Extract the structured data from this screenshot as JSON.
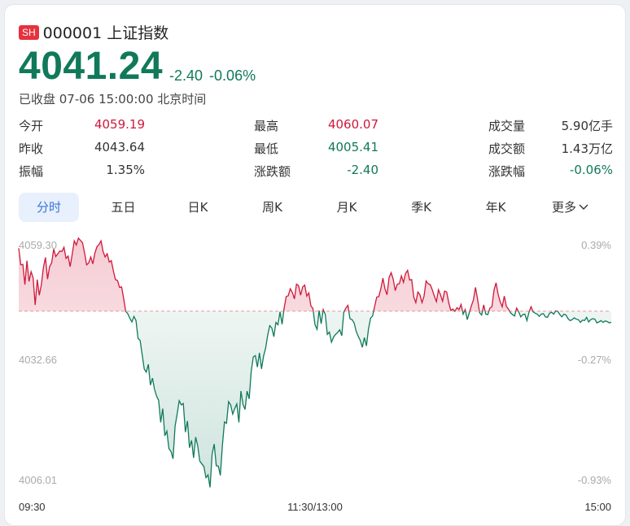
{
  "header": {
    "badge": "SH",
    "title": "000001 上证指数"
  },
  "quote": {
    "price": "4041.24",
    "change": "-2.40",
    "change_pct": "-0.06%",
    "status": "已收盘 07-06 15:00:00 北京时间"
  },
  "stats": [
    {
      "label": "今开",
      "value": "4059.19",
      "color": "red"
    },
    {
      "label": "最高",
      "value": "4060.07",
      "color": "red"
    },
    {
      "label": "成交量",
      "value": "5.90亿手",
      "color": "dark"
    },
    {
      "label": "昨收",
      "value": "4043.64",
      "color": "dark"
    },
    {
      "label": "最低",
      "value": "4005.41",
      "color": "green"
    },
    {
      "label": "成交额",
      "value": "1.43万亿",
      "color": "dark"
    },
    {
      "label": "振幅",
      "value": "1.35%",
      "color": "dark"
    },
    {
      "label": "涨跌额",
      "value": "-2.40",
      "color": "green"
    },
    {
      "label": "涨跌幅",
      "value": "-0.06%",
      "color": "green"
    }
  ],
  "tabs": [
    "分时",
    "五日",
    "日K",
    "周K",
    "月K",
    "季K",
    "年K",
    "更多"
  ],
  "colors": {
    "up": "#d0183a",
    "down": "#10795a",
    "accent": "#3a74d8"
  },
  "chart_data": {
    "type": "line",
    "title": "",
    "x_ticks": [
      "09:30",
      "11:30/13:00",
      "15:00"
    ],
    "y_ticks_left": [
      "4059.30",
      "4032.66",
      "4006.01"
    ],
    "y_ticks_right": [
      "0.39%",
      "-0.27%",
      "-0.93%"
    ],
    "baseline": 4043.64,
    "ylim": [
      4006.01,
      4059.3
    ],
    "grid": false,
    "series": [
      {
        "values": [
          4057.3,
          4053.7,
          4053.8,
          4049.4,
          4054.6,
          4050.1,
          4052.2,
          4050.9,
          4045.0,
          4050.5,
          4047.1,
          4049.4,
          4053.1,
          4055.3,
          4050.6,
          4053.3,
          4054.1,
          4057.1,
          4055.5,
          4056.1,
          4056.7,
          4056.6,
          4057.5,
          4055.1,
          4055.6,
          4053.3,
          4056.0,
          4058.9,
          4058.0,
          4059.5,
          4059.0,
          4058.5,
          4056.3,
          4053.7,
          4054.1,
          4055.4,
          4053.9,
          4056.2,
          4057.6,
          4058.1,
          4058.9,
          4056.6,
          4055.4,
          4056.1,
          4054.3,
          4054.6,
          4052.4,
          4050.5,
          4050.3,
          4048.8,
          4048.9,
          4046.4,
          4043.6,
          4043.1,
          4042.1,
          4041.3,
          4042.5,
          4041.6,
          4037.7,
          4037.3,
          4034.2,
          4031.1,
          4030.4,
          4032.1,
          4027.6,
          4029.1,
          4026.7,
          4025.2,
          4024.3,
          4019.5,
          4022.5,
          4016.6,
          4017.6,
          4013.8,
          4013.2,
          4011.6,
          4018.7,
          4021.3,
          4024.2,
          4023.3,
          4023.6,
          4017.4,
          4019.8,
          4014.0,
          4015.6,
          4011.8,
          4016.3,
          4014.4,
          4011.1,
          4010.5,
          4009.9,
          4007.5,
          4008.1,
          4005.4,
          4012.6,
          4014.8,
          4010.1,
          4010.0,
          4008.0,
          4014.5,
          4019.6,
          4019.3,
          4024.0,
          4023.3,
          4021.3,
          4022.5,
          4023.5,
          4019.5,
          4026.3,
          4023.4,
          4022.3,
          4026.3,
          4024.6,
          4030.6,
          4033.7,
          4034.0,
          4031.5,
          4034.6,
          4031.1,
          4033.9,
          4035.6,
          4038.4,
          4040.5,
          4040.0,
          4038.1,
          4041.2,
          4040.7,
          4043.5,
          4040.8,
          4044.3,
          4046.8,
          4047.0,
          4048.5,
          4047.7,
          4046.3,
          4049.5,
          4049.2,
          4047.1,
          4048.9,
          4049.3,
          4046.9,
          4047.6,
          4044.8,
          4044.2,
          4040.7,
          4039.7,
          4043.8,
          4040.9,
          4044.0,
          4042.9,
          4038.6,
          4039.1,
          4036.9,
          4038.0,
          4038.6,
          4039.0,
          4039.6,
          4038.3,
          4043.4,
          4044.3,
          4044.9,
          4042.0,
          4041.8,
          4041.1,
          4039.3,
          4038.2,
          4037.3,
          4035.8,
          4037.9,
          4036.1,
          4039.8,
          4042.1,
          4042.6,
          4044.7,
          4046.7,
          4046.8,
          4048.5,
          4050.8,
          4048.5,
          4047.2,
          4050.9,
          4052.0,
          4050.6,
          4048.1,
          4049.5,
          4049.6,
          4051.3,
          4049.9,
          4051.8,
          4052.5,
          4050.4,
          4050.5,
          4046.7,
          4045.5,
          4047.8,
          4047.2,
          4045.5,
          4046.9,
          4050.2,
          4049.6,
          4049.4,
          4048.3,
          4046.9,
          4045.7,
          4048.3,
          4047.2,
          4045.8,
          4048.0,
          4047.8,
          4045.5,
          4043.8,
          4044.1,
          4043.6,
          4044.4,
          4044.0,
          4045.1,
          4043.0,
          4044.0,
          4041.8,
          4043.3,
          4044.8,
          4046.1,
          4048.8,
          4046.3,
          4043.3,
          4042.8,
          4045.0,
          4043.0,
          4042.9,
          4044.3,
          4044.6,
          4048.2,
          4049.8,
          4047.3,
          4045.7,
          4044.6,
          4046.9,
          4044.7,
          4044.1,
          4043.3,
          4042.9,
          4042.6,
          4044.3,
          4043.5,
          4042.4,
          4042.9,
          4043.0,
          4041.6,
          4043.4,
          4044.6,
          4043.5,
          4043.2,
          4043.0,
          4042.5,
          4043.0,
          4043.1,
          4042.4,
          4042.3,
          4043.2,
          4043.4,
          4043.0,
          4043.7,
          4043.6,
          4042.9,
          4042.4,
          4043.0,
          4042.8,
          4042.0,
          4041.6,
          4041.8,
          4042.2,
          4041.9,
          4041.8,
          4041.2,
          4041.7,
          4041.6,
          4042.3,
          4041.3,
          4041.8,
          4042.0,
          4041.9,
          4041.1,
          4041.3,
          4041.6,
          4041.2,
          4041.5,
          4041.4,
          4041.1,
          4041.24
        ]
      }
    ]
  }
}
